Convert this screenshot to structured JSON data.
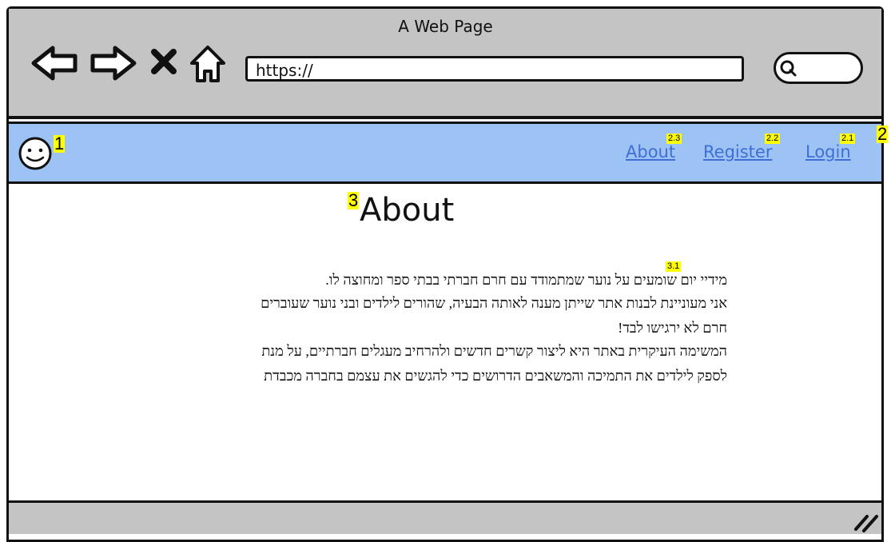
{
  "window": {
    "title": "A Web Page"
  },
  "toolbar": {
    "url_text": "https://",
    "icons": [
      "back-arrow-icon",
      "forward-arrow-icon",
      "close-icon",
      "home-icon",
      "search-icon"
    ]
  },
  "navbar": {
    "annotation_logo": "1",
    "annotation_nav": "2",
    "links": [
      {
        "label": "About",
        "annotation": "2.3"
      },
      {
        "label": "Register",
        "annotation": "2.2"
      },
      {
        "label": "Login",
        "annotation": "2.1"
      }
    ]
  },
  "main": {
    "annotation_heading": "3",
    "heading": "About",
    "annotation_text": "3.1",
    "paragraph_lines": [
      "מידיי יום שומעים על נוער שמתמודד עם חרם חברתי בבתי ספר ומחוצה לו.",
      "אני מעוניינת לבנות אתר שייתן מענה לאותה הבעיה, שהורים לילדים ובני נוער שעוברים",
      "חרם לא ירגישו לבד!",
      "המשימה העיקרית באתר היא ליצור קשרים חדשים ולהרחיב מעגלים חברתיים, על מנת",
      "לספק לילדים את התמיכה והמשאבים הדרושים כדי להגשים את עצמם בחברה מכבדת"
    ]
  },
  "colors": {
    "navbar": "#9dc3f5",
    "chrome": "#c4c4c4",
    "link": "#3f6fd4",
    "annotation": "#ffff00"
  }
}
